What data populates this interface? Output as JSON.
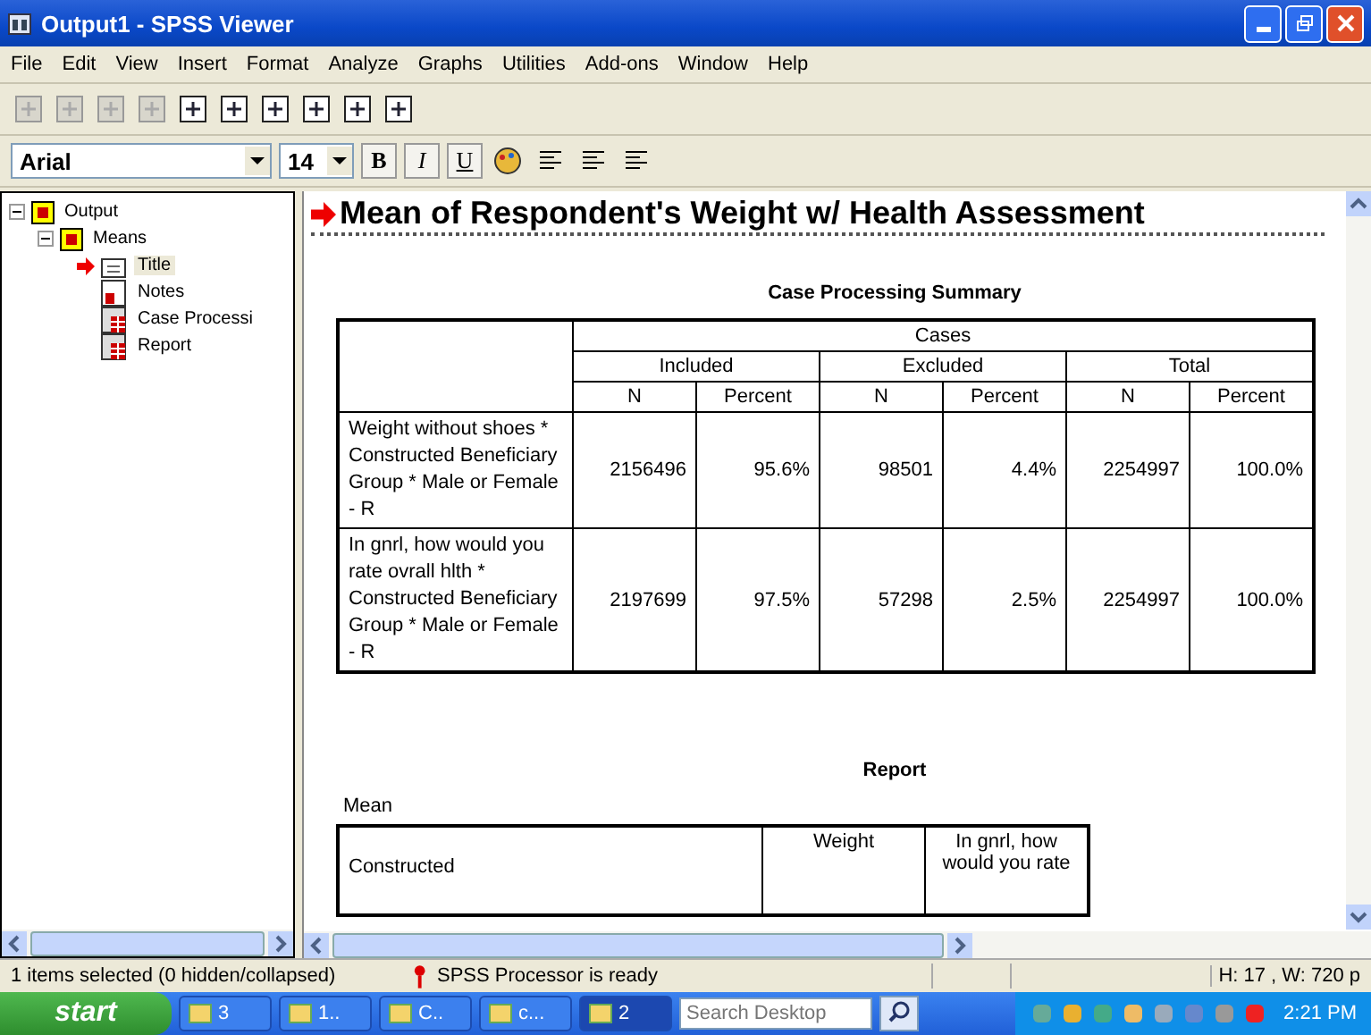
{
  "window": {
    "title": "Output1 - SPSS Viewer"
  },
  "menu": [
    "File",
    "Edit",
    "View",
    "Insert",
    "Format",
    "Analyze",
    "Graphs",
    "Utilities",
    "Add-ons",
    "Window",
    "Help"
  ],
  "format_bar": {
    "font": "Arial",
    "size": "14",
    "bold": "B",
    "italic": "I",
    "underline": "U"
  },
  "tree": [
    {
      "label": "Output",
      "kind": "folder",
      "expanded": true,
      "selected": false,
      "children": [
        {
          "label": "Means",
          "kind": "folder",
          "expanded": true,
          "selected": false,
          "children": [
            {
              "label": "Title",
              "kind": "title",
              "selected": true
            },
            {
              "label": "Notes",
              "kind": "notes",
              "selected": false
            },
            {
              "label": "Case Processi",
              "kind": "table",
              "selected": false
            },
            {
              "label": "Report",
              "kind": "table",
              "selected": false
            }
          ]
        }
      ]
    }
  ],
  "heading": "Mean of Respondent's Weight w/ Health Assessment",
  "case_table": {
    "title": "Case Processing Summary",
    "group": "Cases",
    "groups": [
      "Included",
      "Excluded",
      "Total"
    ],
    "columns": [
      "N",
      "Percent",
      "N",
      "Percent",
      "N",
      "Percent"
    ],
    "rows": [
      {
        "label": "Weight without shoes * Constructed Beneficiary Group * Male or Female  - R",
        "values": [
          "2156496",
          "95.6%",
          "98501",
          "4.4%",
          "2254997",
          "100.0%"
        ]
      },
      {
        "label": "In gnrl, how would you rate ovrall hlth  * Constructed Beneficiary Group * Male or Female  - R",
        "values": [
          "2197699",
          "97.5%",
          "57298",
          "2.5%",
          "2254997",
          "100.0%"
        ]
      }
    ]
  },
  "report": {
    "title": "Report",
    "subtitle": "Mean",
    "columns": [
      "Constructed",
      "Weight",
      "In gnrl, how would you rate"
    ]
  },
  "status_bar": {
    "selection": "1 items selected (0 hidden/collapsed)",
    "processor": "SPSS Processor  is ready",
    "dimensions": "H: 17 , W: 720 p"
  },
  "taskbar": {
    "start": "start",
    "items": [
      {
        "label": "3",
        "selected": false
      },
      {
        "label": "1..",
        "selected": false
      },
      {
        "label": "C..",
        "selected": false
      },
      {
        "label": "c...",
        "selected": false
      },
      {
        "label": "2",
        "selected": true
      }
    ],
    "search": {
      "placeholder": "Search Desktop"
    },
    "clock": "2:21 PM"
  }
}
